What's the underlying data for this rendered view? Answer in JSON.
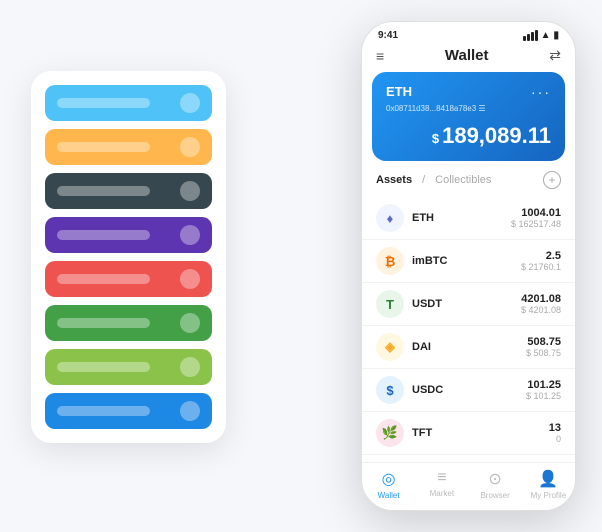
{
  "scene": {
    "background": "#f5f7fa"
  },
  "cardStack": {
    "items": [
      {
        "color": "#4FC3F7",
        "iconColor": "rgba(255,255,255,0.5)"
      },
      {
        "color": "#FFB74D",
        "iconColor": "rgba(255,255,255,0.5)"
      },
      {
        "color": "#37474F",
        "iconColor": "rgba(255,255,255,0.5)"
      },
      {
        "color": "#5E35B1",
        "iconColor": "rgba(255,255,255,0.5)"
      },
      {
        "color": "#EF5350",
        "iconColor": "rgba(255,255,255,0.5)"
      },
      {
        "color": "#43A047",
        "iconColor": "rgba(255,255,255,0.5)"
      },
      {
        "color": "#8BC34A",
        "iconColor": "rgba(255,255,255,0.5)"
      },
      {
        "color": "#1E88E5",
        "iconColor": "rgba(255,255,255,0.5)"
      }
    ]
  },
  "phone": {
    "statusBar": {
      "time": "9:41"
    },
    "header": {
      "title": "Wallet"
    },
    "ethCard": {
      "label": "ETH",
      "address": "0x08711d38...8418a78e3 ☰",
      "balanceSymbol": "$",
      "balance": "189,089.11"
    },
    "assetsSection": {
      "tabActive": "Assets",
      "divider": "/",
      "tabInactive": "Collectibles"
    },
    "assets": [
      {
        "symbol": "ETH",
        "amount": "1004.01",
        "usd": "$ 162517.48",
        "iconBg": "#f0f4ff",
        "iconColor": "#5c6bc0",
        "iconText": "♦"
      },
      {
        "symbol": "imBTC",
        "amount": "2.5",
        "usd": "$ 21760.1",
        "iconBg": "#fff3e0",
        "iconColor": "#ef6c00",
        "iconText": "₿"
      },
      {
        "symbol": "USDT",
        "amount": "4201.08",
        "usd": "$ 4201.08",
        "iconBg": "#e8f5e9",
        "iconColor": "#2e7d32",
        "iconText": "T"
      },
      {
        "symbol": "DAI",
        "amount": "508.75",
        "usd": "$ 508.75",
        "iconBg": "#fff8e1",
        "iconColor": "#f9a825",
        "iconText": "◈"
      },
      {
        "symbol": "USDC",
        "amount": "101.25",
        "usd": "$ 101.25",
        "iconBg": "#e3f2fd",
        "iconColor": "#1565c0",
        "iconText": "$"
      },
      {
        "symbol": "TFT",
        "amount": "13",
        "usd": "0",
        "iconBg": "#fce4ec",
        "iconColor": "#c62828",
        "iconText": "🌿"
      }
    ],
    "bottomNav": [
      {
        "label": "Wallet",
        "icon": "◎",
        "active": true
      },
      {
        "label": "Market",
        "icon": "📊",
        "active": false
      },
      {
        "label": "Browser",
        "icon": "👤",
        "active": false
      },
      {
        "label": "My Profile",
        "icon": "👤",
        "active": false
      }
    ]
  }
}
